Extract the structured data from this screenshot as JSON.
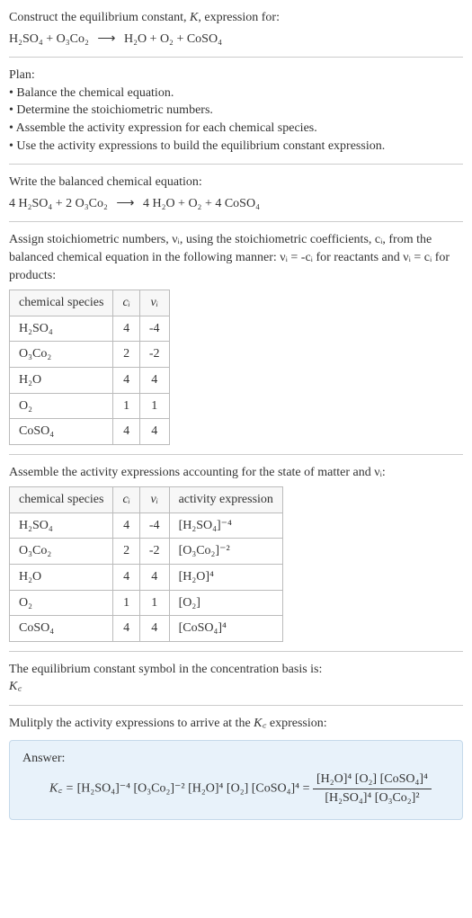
{
  "intro": {
    "line1": "Construct the equilibrium constant, K, expression for:",
    "equation_lhs": "H₂SO₄ + O₃Co₂",
    "arrow": "⟶",
    "equation_rhs": "H₂O + O₂ + CoSO₄"
  },
  "plan": {
    "title": "Plan:",
    "items": [
      "Balance the chemical equation.",
      "Determine the stoichiometric numbers.",
      "Assemble the activity expression for each chemical species.",
      "Use the activity expressions to build the equilibrium constant expression."
    ]
  },
  "balanced": {
    "title": "Write the balanced chemical equation:",
    "lhs": "4 H₂SO₄ + 2 O₃Co₂",
    "arrow": "⟶",
    "rhs": "4 H₂O + O₂ + 4 CoSO₄"
  },
  "stoich": {
    "intro_a": "Assign stoichiometric numbers, νᵢ, using the stoichiometric coefficients, cᵢ, from the balanced chemical equation in the following manner: νᵢ = -cᵢ for reactants and νᵢ = cᵢ for products:",
    "headers": {
      "species": "chemical species",
      "c": "cᵢ",
      "v": "νᵢ"
    },
    "rows": [
      {
        "species": "H₂SO₄",
        "c": "4",
        "v": "-4"
      },
      {
        "species": "O₃Co₂",
        "c": "2",
        "v": "-2"
      },
      {
        "species": "H₂O",
        "c": "4",
        "v": "4"
      },
      {
        "species": "O₂",
        "c": "1",
        "v": "1"
      },
      {
        "species": "CoSO₄",
        "c": "4",
        "v": "4"
      }
    ]
  },
  "activity": {
    "intro": "Assemble the activity expressions accounting for the state of matter and νᵢ:",
    "headers": {
      "species": "chemical species",
      "c": "cᵢ",
      "v": "νᵢ",
      "expr": "activity expression"
    },
    "rows": [
      {
        "species": "H₂SO₄",
        "c": "4",
        "v": "-4",
        "expr": "[H₂SO₄]⁻⁴"
      },
      {
        "species": "O₃Co₂",
        "c": "2",
        "v": "-2",
        "expr": "[O₃Co₂]⁻²"
      },
      {
        "species": "H₂O",
        "c": "4",
        "v": "4",
        "expr": "[H₂O]⁴"
      },
      {
        "species": "O₂",
        "c": "1",
        "v": "1",
        "expr": "[O₂]"
      },
      {
        "species": "CoSO₄",
        "c": "4",
        "v": "4",
        "expr": "[CoSO₄]⁴"
      }
    ]
  },
  "kc_symbol": {
    "line1": "The equilibrium constant symbol in the concentration basis is:",
    "symbol": "K꜀"
  },
  "multiply": {
    "line": "Mulitply the activity expressions to arrive at the K꜀ expression:"
  },
  "answer": {
    "label": "Answer:",
    "kc": "K꜀ = ",
    "product_form": "[H₂SO₄]⁻⁴ [O₃Co₂]⁻² [H₂O]⁴ [O₂] [CoSO₄]⁴ = ",
    "frac_num": "[H₂O]⁴ [O₂] [CoSO₄]⁴",
    "frac_den": "[H₂SO₄]⁴ [O₃Co₂]²"
  }
}
